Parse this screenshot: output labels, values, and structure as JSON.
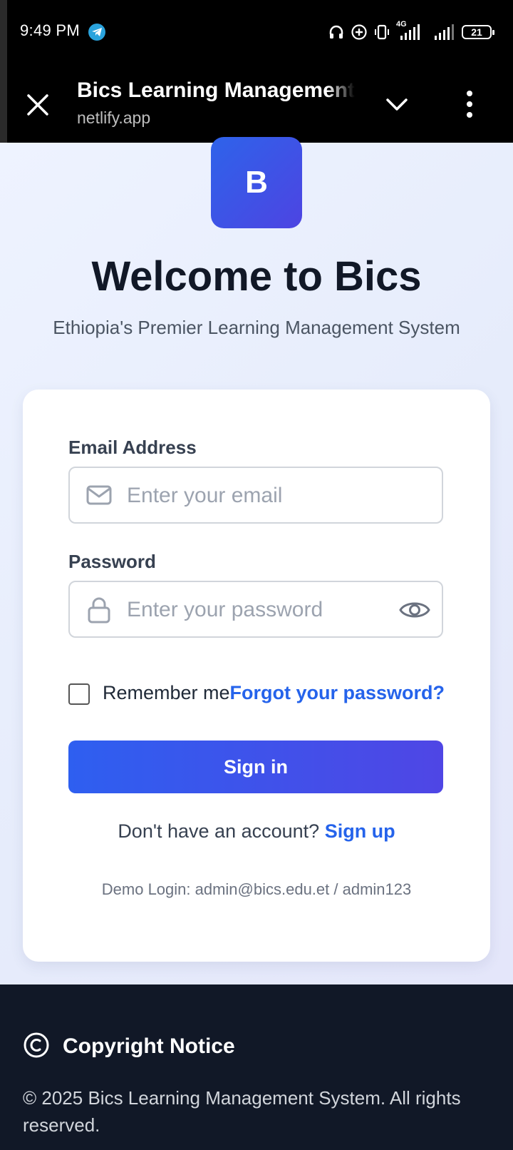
{
  "status_bar": {
    "time": "9:49 PM",
    "network": "4G",
    "battery": "21"
  },
  "browser": {
    "title": "Bics Learning Management",
    "domain": "netlify.app"
  },
  "hero": {
    "logo_letter": "B",
    "title": "Welcome to Bics",
    "subtitle": "Ethiopia's Premier Learning Management System"
  },
  "form": {
    "email_label": "Email Address",
    "email_placeholder": "Enter your email",
    "password_label": "Password",
    "password_placeholder": "Enter your password",
    "remember_label": "Remember me",
    "forgot_label": "Forgot your password?",
    "signin_label": "Sign in",
    "no_account_text": "Don't have an account?",
    "signup_label": "Sign up",
    "demo_text": "Demo Login: admin@bics.edu.et / admin123"
  },
  "footer": {
    "heading": "Copyright Notice",
    "text": "© 2025 Bics Learning Management System. All rights reserved."
  },
  "colors": {
    "accent": "#2563eb",
    "button_gradient_start": "#2e5ff0",
    "button_gradient_end": "#4f46e5",
    "footer_bg": "#111827"
  }
}
